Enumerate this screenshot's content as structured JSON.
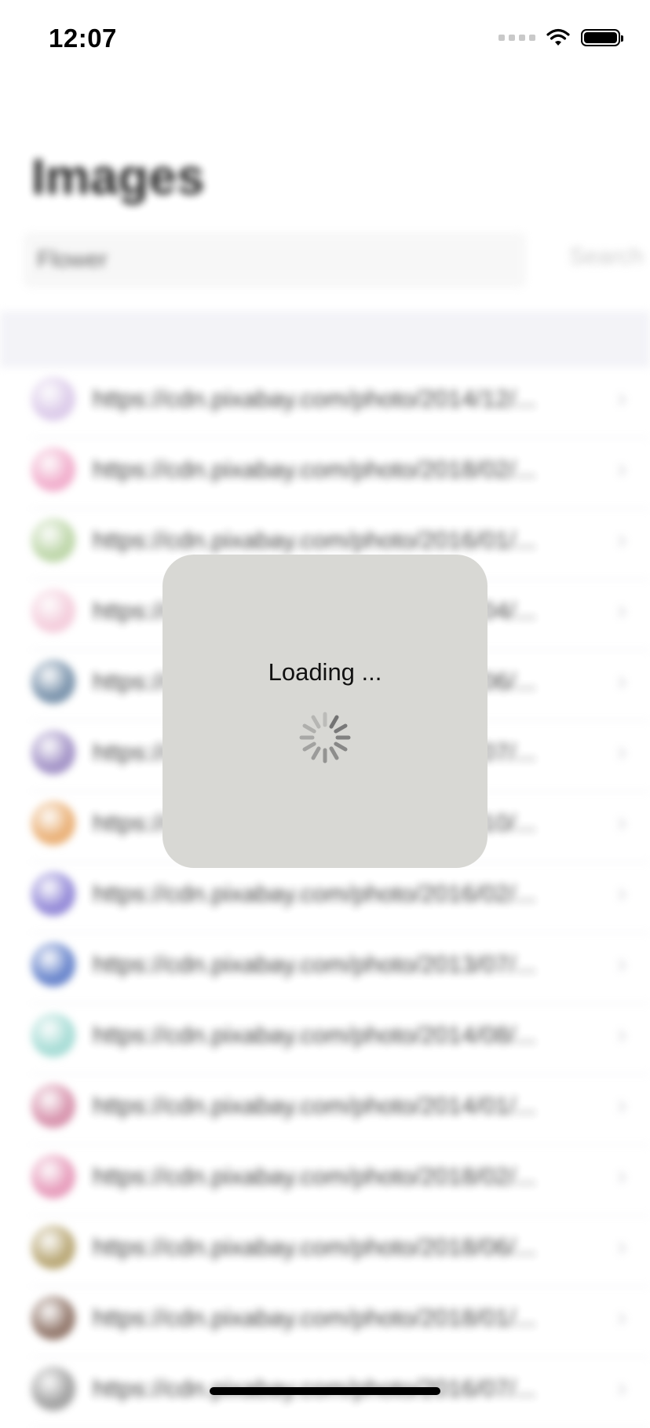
{
  "status_bar": {
    "time": "12:07"
  },
  "page": {
    "title": "Images",
    "search": {
      "value": "Flower",
      "button_label": "Search"
    }
  },
  "list": {
    "items": [
      {
        "text": "https://cdn.pixabay.com/photo/2014/12/...",
        "avatar_color": "#d9c7e8"
      },
      {
        "text": "https://cdn.pixabay.com/photo/2018/02/...",
        "avatar_color": "#f0a7c8"
      },
      {
        "text": "https://cdn.pixabay.com/photo/2016/01/...",
        "avatar_color": "#b8d3a2"
      },
      {
        "text": "https://cdn.pixabay.com/photo/2014/04/...",
        "avatar_color": "#f3c9d9"
      },
      {
        "text": "https://cdn.pixabay.com/photo/2018/06/...",
        "avatar_color": "#6f8aa5"
      },
      {
        "text": "https://cdn.pixabay.com/photo/2013/07/...",
        "avatar_color": "#9b8ac2"
      },
      {
        "text": "https://cdn.pixabay.com/photo/2018/10/...",
        "avatar_color": "#e8a96a"
      },
      {
        "text": "https://cdn.pixabay.com/photo/2016/02/...",
        "avatar_color": "#8a7fd4"
      },
      {
        "text": "https://cdn.pixabay.com/photo/2013/07/...",
        "avatar_color": "#5a79c7"
      },
      {
        "text": "https://cdn.pixabay.com/photo/2014/08/...",
        "avatar_color": "#9fd9d2"
      },
      {
        "text": "https://cdn.pixabay.com/photo/2014/01/...",
        "avatar_color": "#d48aa6"
      },
      {
        "text": "https://cdn.pixabay.com/photo/2018/02/...",
        "avatar_color": "#e594b6"
      },
      {
        "text": "https://cdn.pixabay.com/photo/2018/06/...",
        "avatar_color": "#b3a06a"
      },
      {
        "text": "https://cdn.pixabay.com/photo/2018/01/...",
        "avatar_color": "#8a6d60"
      },
      {
        "text": "https://cdn.pixabay.com/photo/2016/07/...",
        "avatar_color": "#9a9a9a"
      }
    ]
  },
  "hud": {
    "label": "Loading ...",
    "spinner_icon": "activity-indicator-icon"
  }
}
